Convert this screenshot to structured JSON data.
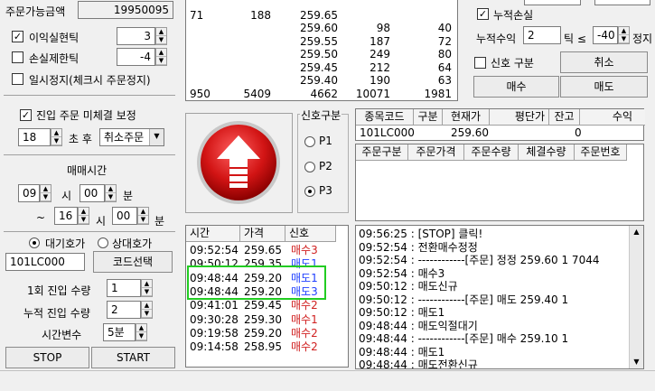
{
  "left": {
    "avail_label": "주문가능금액",
    "avail_value": "19950095",
    "profit_take": {
      "label": "이익실현틱",
      "checked": true,
      "value": "3"
    },
    "loss_cut": {
      "label": "손실제한틱",
      "checked": false,
      "value": "-4"
    },
    "pause": {
      "label": "일시정지(체크시 주문정지)",
      "checked": false
    },
    "unfilled": {
      "label": "진입 주문 미체결 보정",
      "checked": true,
      "seconds": "18",
      "after_label": "초 후",
      "action": "취소주문"
    },
    "trade_time": {
      "title": "매매시간",
      "start_hour": "09",
      "start_min": "00",
      "end_hour": "16",
      "end_min": "00",
      "hour_label": "시",
      "min_label": "분",
      "tilde": "~"
    },
    "quote": {
      "waiting_label": "대기호가",
      "opposite_label": "상대호가",
      "code": "101LC000",
      "code_btn": "코드선택"
    },
    "entry_qty": {
      "label": "1회 진입 수량",
      "value": "1"
    },
    "cum_qty": {
      "label": "누적 진입 수량",
      "value": "2"
    },
    "time_var": {
      "label": "시간변수",
      "value": "5분"
    },
    "stop_btn": "STOP",
    "start_btn": "START"
  },
  "orderbook": {
    "rows": [
      [
        "",
        "",
        "",
        "",
        ""
      ],
      [
        "71",
        "188",
        "259.65",
        "",
        ""
      ],
      [
        "",
        "",
        "259.60",
        "98",
        "40"
      ],
      [
        "",
        "",
        "259.55",
        "187",
        "72"
      ],
      [
        "",
        "",
        "259.50",
        "249",
        "80"
      ],
      [
        "",
        "",
        "259.45",
        "212",
        "64"
      ],
      [
        "",
        "",
        "259.40",
        "190",
        "63"
      ],
      [
        "950",
        "5409",
        "4662",
        "10071",
        "1981"
      ]
    ]
  },
  "signal_group": {
    "title": "신호구분",
    "options": [
      "P1",
      "P2",
      "P3"
    ],
    "selected": "P3"
  },
  "signal_log": {
    "headers": [
      "시간",
      "가격",
      "신호"
    ],
    "rows": [
      {
        "time": "09:52:54",
        "price": "259.65",
        "signal": "매수3",
        "color": "red"
      },
      {
        "time": "09:50:12",
        "price": "259.35",
        "signal": "매도1",
        "color": "blue"
      },
      {
        "time": "09:48:44",
        "price": "259.20",
        "signal": "매도1",
        "color": "blue"
      },
      {
        "time": "09:48:44",
        "price": "259.20",
        "signal": "매도3",
        "color": "blue"
      },
      {
        "time": "09:41:01",
        "price": "259.45",
        "signal": "매수2",
        "color": "red"
      },
      {
        "time": "09:30:28",
        "price": "259.30",
        "signal": "매수1",
        "color": "red"
      },
      {
        "time": "09:19:58",
        "price": "259.20",
        "signal": "매수2",
        "color": "red"
      },
      {
        "time": "09:14:58",
        "price": "258.95",
        "signal": "매수2",
        "color": "red"
      }
    ]
  },
  "right_top": {
    "cum_loss": {
      "label": "누적손실",
      "checked": true
    },
    "cum_profit_label": "누적수익",
    "cum_profit_value": "2",
    "tick_label": "틱 ≤",
    "tick_value": "-40",
    "stop_label": "정지",
    "signal_cb": {
      "label": "신호 구분",
      "checked": false
    },
    "cancel_btn": "취소",
    "buy_btn": "매수",
    "sell_btn": "매도"
  },
  "position": {
    "headers": [
      "종목코드",
      "구분",
      "현재가",
      "평단가",
      "잔고",
      "수익"
    ],
    "row": [
      "101LC000",
      "",
      "259.60",
      "",
      "0",
      ""
    ]
  },
  "orders": {
    "headers": [
      "주문구분",
      "주문가격",
      "주문수량",
      "체결수량",
      "주문번호"
    ]
  },
  "log": {
    "lines": [
      "09:56:25 : [STOP] 클릭!",
      "09:52:54 : 전환매수정정",
      "09:52:54 : ------------[주문] 정정 259.60 1 7044",
      "09:52:54 : 매수3",
      "09:50:12 : 매도신규",
      "09:50:12 : ------------[주문] 매도 259.40 1",
      "09:50:12 : 매도1",
      "09:48:44 : 매도익절대기",
      "09:48:44 : ------------[주문] 매수 259.10 1",
      "09:48:44 : 매도1",
      "09:48:44 : 매도전환신규"
    ]
  }
}
